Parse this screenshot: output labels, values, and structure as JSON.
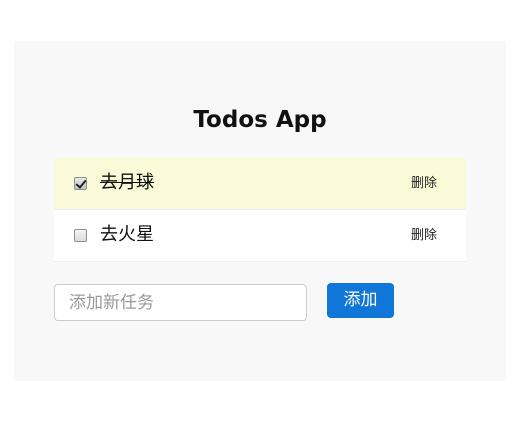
{
  "app": {
    "title": "Todos App"
  },
  "todos": [
    {
      "text": "去月球",
      "completed": true,
      "delete_label": "删除"
    },
    {
      "text": "去火星",
      "completed": false,
      "delete_label": "删除"
    }
  ],
  "new_task": {
    "value": "",
    "placeholder": "添加新任务",
    "add_label": "添加"
  },
  "colors": {
    "panel_background": "#f8f8f8",
    "completed_row_background": "#fafad8",
    "add_button": "#1076d8"
  }
}
